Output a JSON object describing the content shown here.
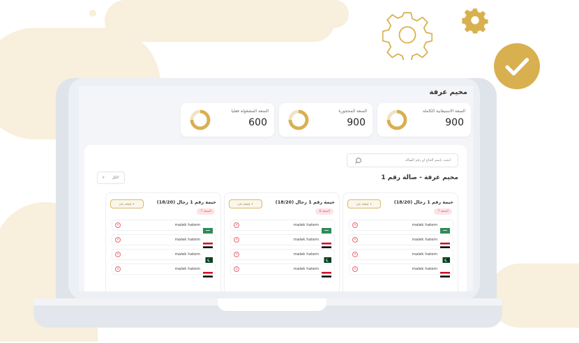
{
  "colors": {
    "accent": "#d9b04f",
    "background_blob": "#f8efdc",
    "badge_bg": "#fde3e6",
    "badge_text": "#e25a6a"
  },
  "decor": {
    "gear_icons": [
      "gear-outline-icon",
      "gear-solid-icon"
    ],
    "check_icon": "check-circle-icon"
  },
  "page": {
    "title": "مخيم عرفة"
  },
  "stats": [
    {
      "label": "السعة الاستيعابية الكاملة",
      "value": "900"
    },
    {
      "label": "السعة المحجوزة",
      "value": "900"
    },
    {
      "label": "السعة المشغولة فعليا",
      "value": "600"
    }
  ],
  "search": {
    "placeholder": "ابحث باسم الحاج او رقم الصالة"
  },
  "filter": {
    "selected": "الكل"
  },
  "hall": {
    "title": "مخيم عرفة - صالة رقم 1"
  },
  "tents": [
    {
      "title": "خيمة رقم 1 رجال (18/20)",
      "capacity_badge": "السعة 7",
      "add_label": "+ إضافة حاج",
      "pilgrims": [
        {
          "name": "malek hatem",
          "flag": "saudi-arabia"
        },
        {
          "name": "malek hatem",
          "flag": "egypt"
        },
        {
          "name": "malek hatem",
          "flag": "pakistan"
        },
        {
          "name": "malek hatem",
          "flag": "egypt"
        }
      ]
    },
    {
      "title": "خيمة رقم 1 رجال (18/20)",
      "capacity_badge": "السعة 8",
      "add_label": "+ إضافة حاج",
      "pilgrims": [
        {
          "name": "malek hatem",
          "flag": "saudi-arabia"
        },
        {
          "name": "malek hatem",
          "flag": "egypt"
        },
        {
          "name": "malek hatem",
          "flag": "pakistan"
        },
        {
          "name": "malek hatem",
          "flag": "egypt"
        }
      ]
    },
    {
      "title": "خيمة رقم 1 رجال (18/20)",
      "capacity_badge": "السعة 7",
      "add_label": "+ إضافة حاج",
      "pilgrims": [
        {
          "name": "malek hatem",
          "flag": "saudi-arabia"
        },
        {
          "name": "malek hatem",
          "flag": "egypt"
        },
        {
          "name": "malek hatem",
          "flag": "pakistan"
        },
        {
          "name": "malek hatem",
          "flag": "egypt"
        }
      ]
    }
  ]
}
